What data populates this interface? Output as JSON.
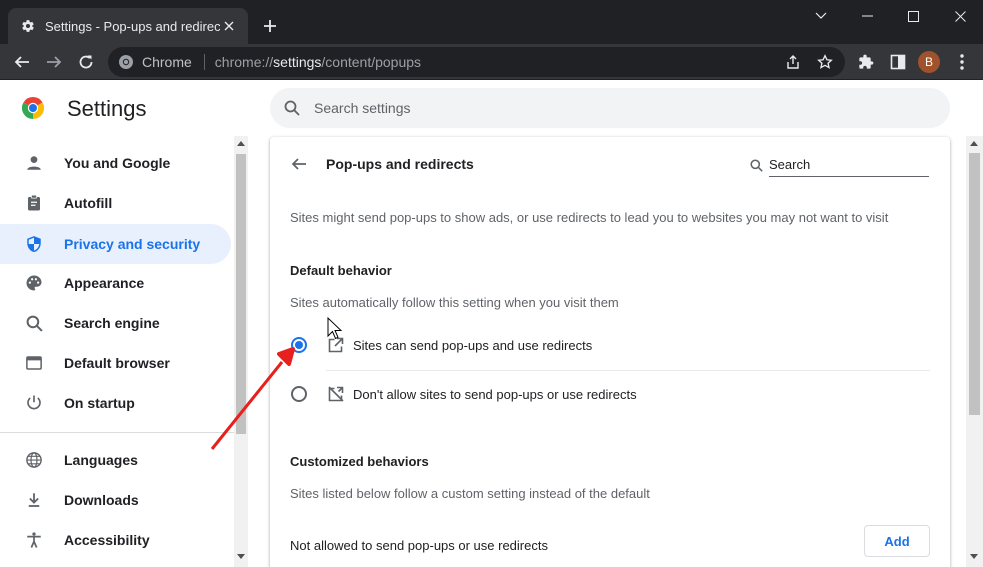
{
  "tab": {
    "title": "Settings - Pop-ups and redirects",
    "icon": "gear-icon"
  },
  "omnibox": {
    "site_name": "Chrome",
    "url_scheme": "chrome://",
    "url_host": "settings",
    "url_path": "/content/popups"
  },
  "profile": {
    "initial": "B",
    "color": "#a0522d"
  },
  "settings": {
    "title": "Settings",
    "search_placeholder": "Search settings"
  },
  "sidebar": {
    "items": [
      {
        "label": "You and Google",
        "icon": "person-icon"
      },
      {
        "label": "Autofill",
        "icon": "clipboard-icon"
      },
      {
        "label": "Privacy and security",
        "icon": "shield-icon",
        "active": true
      },
      {
        "label": "Appearance",
        "icon": "palette-icon"
      },
      {
        "label": "Search engine",
        "icon": "search-icon"
      },
      {
        "label": "Default browser",
        "icon": "browser-icon"
      },
      {
        "label": "On startup",
        "icon": "power-icon"
      },
      {
        "label": "Languages",
        "icon": "globe-icon"
      },
      {
        "label": "Downloads",
        "icon": "download-icon"
      },
      {
        "label": "Accessibility",
        "icon": "accessibility-icon"
      }
    ]
  },
  "page": {
    "title": "Pop-ups and redirects",
    "search_placeholder": "Search",
    "description": "Sites might send pop-ups to show ads, or use redirects to lead you to websites you may not want to visit",
    "default_heading": "Default behavior",
    "default_sub": "Sites automatically follow this setting when you visit them",
    "options": [
      {
        "label": "Sites can send pop-ups and use redirects",
        "checked": true,
        "icon": "open-in-new-icon"
      },
      {
        "label": "Don't allow sites to send pop-ups or use redirects",
        "checked": false,
        "icon": "popup-blocked-icon"
      }
    ],
    "custom_heading": "Customized behaviors",
    "custom_sub": "Sites listed below follow a custom setting instead of the default",
    "not_allowed_label": "Not allowed to send pop-ups or use redirects",
    "add_label": "Add"
  },
  "colors": {
    "accent": "#1a73e8",
    "annotation_arrow": "#e8201d"
  }
}
